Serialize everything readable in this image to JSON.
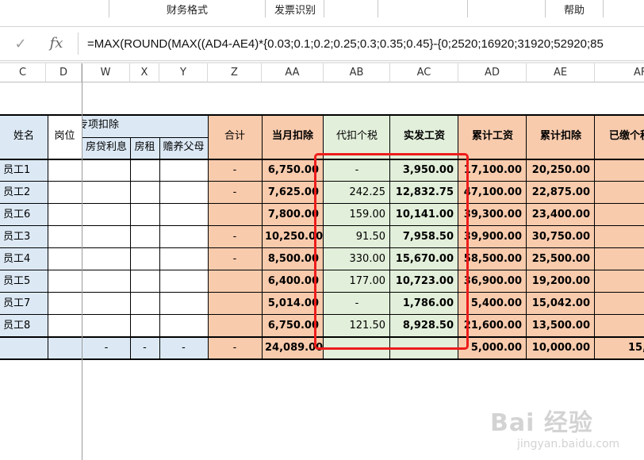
{
  "ribbon": {
    "tabs": [
      "财务格式",
      "发票识别",
      "帮助"
    ]
  },
  "formula_bar": {
    "check_icon": "✓",
    "fx_label": "fx",
    "formula": "=MAX(ROUND(MAX((AD4-AE4)*{0.03;0.1;0.2;0.25;0.3;0.35;0.45}-{0;2520;16920;31920;52920;85"
  },
  "columns": [
    "C",
    "D",
    "W",
    "X",
    "Y",
    "Z",
    "AA",
    "AB",
    "AC",
    "AD",
    "AE",
    "AF"
  ],
  "headers": {
    "name": "姓名",
    "position": "岗位",
    "special_deduction": "专项扣除",
    "sub_headers": [
      "房贷利息",
      "房租",
      "赡养父母"
    ],
    "total": "合计",
    "monthly_deduction": "当月扣除",
    "tax_withheld": "代扣个税",
    "net_salary": "实发工资",
    "cumulative_salary": "累计工资",
    "cumulative_deduction": "累计扣除",
    "paid_tax": "已缴个税"
  },
  "rows": [
    {
      "name": "员工1",
      "total": "-",
      "monthly_deduction": "6,750.00",
      "tax_withheld": "-",
      "net_salary": "3,950.00",
      "cumulative_salary": "17,100.00",
      "cumulative_deduction": "20,250.00"
    },
    {
      "name": "员工2",
      "total": "-",
      "monthly_deduction": "7,625.00",
      "tax_withheld": "242.25",
      "net_salary": "12,832.75",
      "cumulative_salary": "47,100.00",
      "cumulative_deduction": "22,875.00"
    },
    {
      "name": "员工6",
      "total": "",
      "monthly_deduction": "7,800.00",
      "tax_withheld": "159.00",
      "net_salary": "10,141.00",
      "cumulative_salary": "39,300.00",
      "cumulative_deduction": "23,400.00"
    },
    {
      "name": "员工3",
      "total": "-",
      "monthly_deduction": "10,250.00",
      "tax_withheld": "91.50",
      "net_salary": "7,958.50",
      "cumulative_salary": "39,900.00",
      "cumulative_deduction": "30,750.00"
    },
    {
      "name": "员工4",
      "total": "-",
      "monthly_deduction": "8,500.00",
      "tax_withheld": "330.00",
      "net_salary": "15,670.00",
      "cumulative_salary": "58,500.00",
      "cumulative_deduction": "25,500.00"
    },
    {
      "name": "员工5",
      "total": "",
      "monthly_deduction": "6,400.00",
      "tax_withheld": "177.00",
      "net_salary": "10,723.00",
      "cumulative_salary": "36,900.00",
      "cumulative_deduction": "19,200.00"
    },
    {
      "name": "员工7",
      "total": "",
      "monthly_deduction": "5,014.00",
      "tax_withheld": "-",
      "net_salary": "1,786.00",
      "cumulative_salary": "5,400.00",
      "cumulative_deduction": "15,042.00"
    },
    {
      "name": "员工8",
      "total": "",
      "monthly_deduction": "6,750.00",
      "tax_withheld": "121.50",
      "net_salary": "8,928.50",
      "cumulative_salary": "21,600.00",
      "cumulative_deduction": "13,500.00"
    }
  ],
  "totals": {
    "housing_interest": "-",
    "rent": "-",
    "parents": "-",
    "total": "-",
    "monthly_deduction": "24,089.00",
    "cumulative_salary": "5,000.00",
    "cumulative_deduction": "10,000.00",
    "paid_tax": "15,"
  },
  "watermark": {
    "line1": "Bai 经验",
    "line2": "jingyan.baidu.com"
  },
  "colors": {
    "blue": "#dce9f5",
    "peach": "#f8cbad",
    "green": "#e2efda",
    "highlight": "#ee1c1c"
  }
}
